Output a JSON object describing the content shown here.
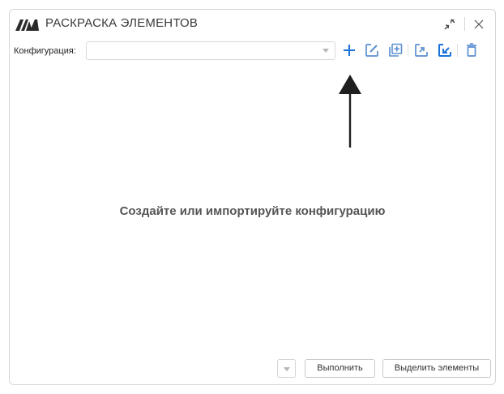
{
  "window": {
    "title": "РАСКРАСКА ЭЛЕМЕНТОВ"
  },
  "toolbar": {
    "config_label": "Конфигурация:",
    "config_value": "",
    "icons": [
      "plus-icon",
      "edit-icon",
      "duplicate-icon",
      "export-icon",
      "import-icon",
      "trash-icon"
    ]
  },
  "main": {
    "empty_message": "Создайте или импортируйте конфигурацию"
  },
  "footer": {
    "run_label": "Выполнить",
    "select_label": "Выделить элементы"
  },
  "colors": {
    "accent": "#1a73d9",
    "muted_icon": "#5a8fd0",
    "annotation": "#1f1f1f"
  }
}
